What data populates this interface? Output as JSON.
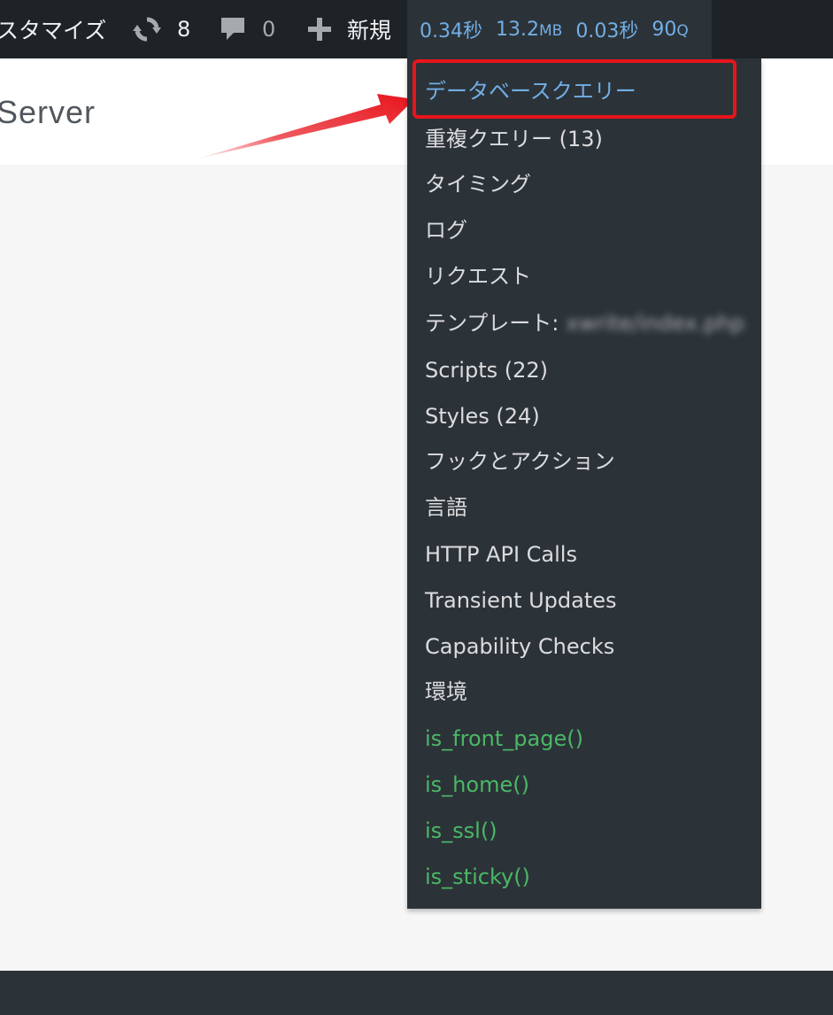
{
  "adminbar": {
    "customize_label": "スタマイズ",
    "updates_count": "8",
    "comments_count": "0",
    "new_label": "新規",
    "qm": {
      "time": "0.34秒",
      "memory_value": "13.2",
      "memory_unit": "MB",
      "db_time": "0.03秒",
      "queries": "90",
      "queries_unit": "Q"
    }
  },
  "page": {
    "title": "Server"
  },
  "menu": {
    "items": [
      {
        "label": "データベースクエリー",
        "type": "active"
      },
      {
        "label": "重複クエリー (13)",
        "type": "normal"
      },
      {
        "label": "タイミング",
        "type": "normal"
      },
      {
        "label": "ログ",
        "type": "normal"
      },
      {
        "label": "リクエスト",
        "type": "normal"
      },
      {
        "label": "テンプレート:",
        "blurred": "xwrite/index.php",
        "type": "normal"
      },
      {
        "label": "Scripts (22)",
        "type": "normal"
      },
      {
        "label": "Styles (24)",
        "type": "normal"
      },
      {
        "label": "フックとアクション",
        "type": "normal"
      },
      {
        "label": "言語",
        "type": "normal"
      },
      {
        "label": "HTTP API Calls",
        "type": "normal"
      },
      {
        "label": "Transient Updates",
        "type": "normal"
      },
      {
        "label": "Capability Checks",
        "type": "normal"
      },
      {
        "label": "環境",
        "type": "normal"
      },
      {
        "label": "is_front_page()",
        "type": "conditional"
      },
      {
        "label": "is_home()",
        "type": "conditional"
      },
      {
        "label": "is_ssl()",
        "type": "conditional"
      },
      {
        "label": "is_sticky()",
        "type": "conditional"
      }
    ]
  },
  "colors": {
    "adminbar_bg": "#1d2327",
    "menu_bg": "#2c3338",
    "link_blue": "#72aee6",
    "conditional_green": "#4ab866",
    "highlight_red": "#e8141c"
  },
  "icons": [
    "updates-icon",
    "comments-icon",
    "plus-icon",
    "red-arrow-annotation"
  ]
}
